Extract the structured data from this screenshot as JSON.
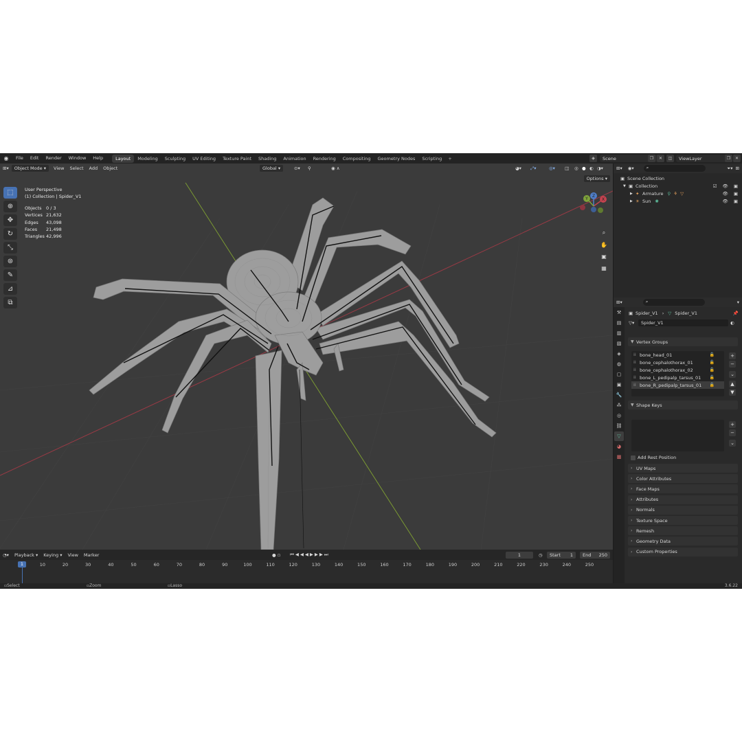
{
  "topbar": {
    "menus": [
      "File",
      "Edit",
      "Render",
      "Window",
      "Help"
    ],
    "workspaces": [
      "Layout",
      "Modeling",
      "Sculpting",
      "UV Editing",
      "Texture Paint",
      "Shading",
      "Animation",
      "Rendering",
      "Compositing",
      "Geometry Nodes",
      "Scripting"
    ],
    "add_label": "+",
    "scene": "Scene",
    "view_layer": "ViewLayer"
  },
  "viewport": {
    "mode": "Object Mode",
    "menus": [
      "View",
      "Select",
      "Add",
      "Object"
    ],
    "transform_orientation": "Global",
    "options_label": "Options",
    "perspective_label": "User Perspective",
    "collection_label": "(1) Collection | Spider_V1",
    "stats": [
      {
        "key": "Objects",
        "value": "0 / 3"
      },
      {
        "key": "Vertices",
        "value": "21,632"
      },
      {
        "key": "Edges",
        "value": "43,098"
      },
      {
        "key": "Faces",
        "value": "21,498"
      },
      {
        "key": "Triangles",
        "value": "42,996"
      }
    ],
    "gizmo_axes": [
      "X",
      "Y",
      "Z"
    ],
    "tools": [
      "select-box-icon",
      "cursor-icon",
      "move-icon",
      "rotate-icon",
      "scale-icon",
      "transform-icon",
      "annotate-icon",
      "measure-icon",
      "add-cube-icon"
    ]
  },
  "timeline": {
    "menus": [
      "Playback",
      "Keying",
      "View",
      "Marker"
    ],
    "current_frame": "1",
    "start_label": "Start",
    "start": "1",
    "end_label": "End",
    "end": "250",
    "ticks": [
      "1",
      "10",
      "20",
      "30",
      "40",
      "50",
      "60",
      "70",
      "80",
      "90",
      "100",
      "110",
      "120",
      "130",
      "140",
      "150",
      "160",
      "170",
      "180",
      "190",
      "200",
      "210",
      "220",
      "230",
      "240",
      "250"
    ]
  },
  "statusbar": {
    "select": "Select",
    "zoom": "Zoom View",
    "lasso": "Lasso Select",
    "version": "3.6.22"
  },
  "outliner": {
    "root": "Scene Collection",
    "collection": "Collection",
    "items": [
      "Armature",
      "Sun"
    ]
  },
  "properties": {
    "breadcrumb_object": "Spider_V1",
    "breadcrumb_mesh": "Spider_V1",
    "mesh_name": "Spider_V1",
    "vertex_groups_title": "Vertex Groups",
    "vertex_groups": [
      "bone_head_01",
      "bone_cephalothorax_01",
      "bone_cephalothorax_02",
      "bone_L_pedipalp_tarsus_01",
      "bone_R_pedipalp_tarsus_01"
    ],
    "shape_keys_title": "Shape Keys",
    "add_rest_position": "Add Rest Position",
    "collapsed_panels": [
      "UV Maps",
      "Color Attributes",
      "Face Maps",
      "Attributes",
      "Normals",
      "Texture Space",
      "Remesh",
      "Geometry Data",
      "Custom Properties"
    ]
  },
  "colors": {
    "accent": "#4772b3",
    "viewport_bg": "#3b3b3b",
    "x_axis": "#9a3a45",
    "y_axis": "#7b9a33"
  }
}
